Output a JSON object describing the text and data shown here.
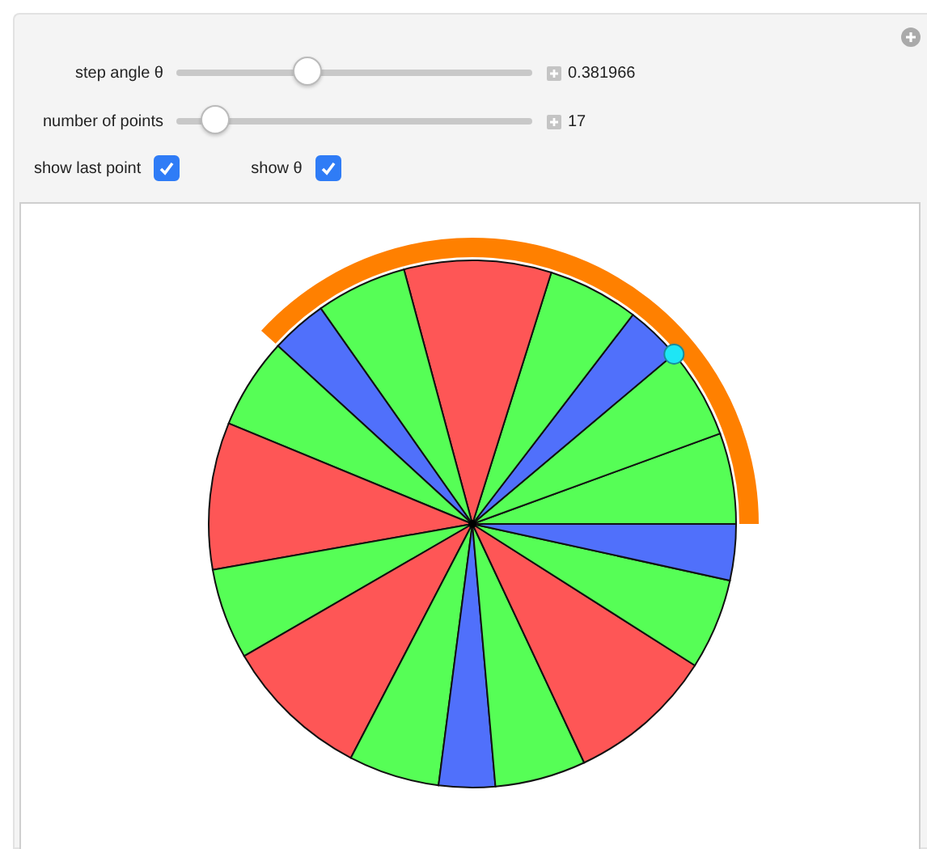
{
  "sliders": [
    {
      "label": "step angle θ",
      "level": 0.37,
      "value": "0.381966"
    },
    {
      "label": "number of points",
      "level": 0.11,
      "value": "17"
    }
  ],
  "checkboxes": [
    {
      "label": "show last point",
      "checked": true
    },
    {
      "label": "show θ",
      "checked": true
    }
  ]
}
